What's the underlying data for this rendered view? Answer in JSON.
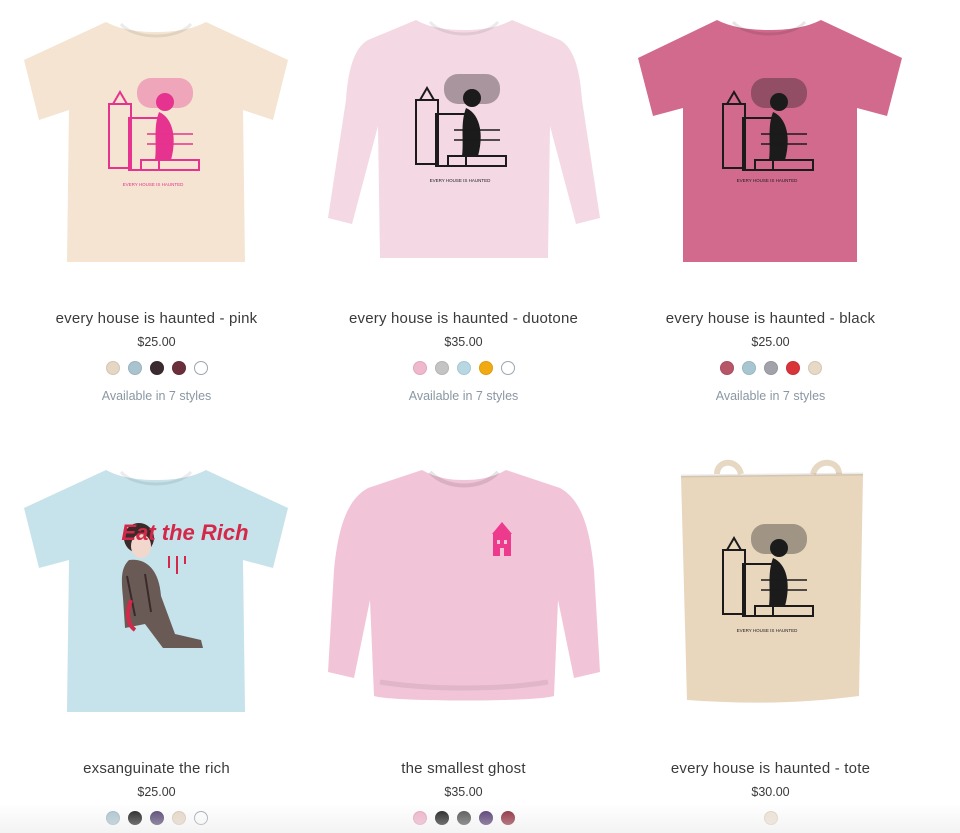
{
  "products": [
    {
      "title": "every house is haunted - pink",
      "price": "$25.00",
      "styles_text": "Available in 7 styles",
      "garment": "tshirt",
      "garment_color": "#f4e4d1",
      "print_color": "#e6338f",
      "print_caption": "EVERY HOUSE IS HAUNTED",
      "swatches": [
        "#e6d6c4",
        "#a9c3cf",
        "#3b2a30",
        "#6a2f3b",
        "#ffffff"
      ]
    },
    {
      "title": "every house is haunted - duotone",
      "price": "$35.00",
      "styles_text": "Available in 7 styles",
      "garment": "longsleeve",
      "garment_color": "#f4d8e4",
      "print_color": "#1b1b1b",
      "print_caption": "EVERY HOUSE IS HAUNTED",
      "swatches": [
        "#f0b8cc",
        "#c4c4c4",
        "#b7d8e2",
        "#f2aa12",
        "#ffffff"
      ]
    },
    {
      "title": "every house is haunted - black",
      "price": "$25.00",
      "styles_text": "Available in 7 styles",
      "garment": "tshirt",
      "garment_color": "#d26a8e",
      "print_color": "#1b1b1b",
      "print_caption": "EVERY HOUSE IS HAUNTED",
      "swatches": [
        "#b65668",
        "#a8c6d2",
        "#a2a2aa",
        "#d8343a",
        "#e8d8c6"
      ]
    },
    {
      "title": "exsanguinate the rich",
      "price": "$25.00",
      "styles_text": "",
      "garment": "tshirt",
      "garment_color": "#c6e2ea",
      "print_color": "#d4284a",
      "print_caption": "Eat the Rich",
      "swatches": [
        "#a9c3cf",
        "#111111",
        "#4b3a6a",
        "#e6d6c4",
        "#ffffff"
      ]
    },
    {
      "title": "the smallest ghost",
      "price": "$35.00",
      "styles_text": "",
      "garment": "sweatshirt",
      "garment_color": "#f2c4d8",
      "print_color": "#ee3a8c",
      "print_caption": "",
      "swatches": [
        "#f0b0c8",
        "#111111",
        "#4a4a4a",
        "#4b2f6a",
        "#8a1f2f"
      ]
    },
    {
      "title": "every house is haunted - tote",
      "price": "$30.00",
      "styles_text": "",
      "garment": "tote",
      "garment_color": "#e8d6bd",
      "print_color": "#1b1b1b",
      "print_caption": "EVERY HOUSE IS HAUNTED",
      "swatches": [
        "#eee2d2"
      ]
    }
  ]
}
